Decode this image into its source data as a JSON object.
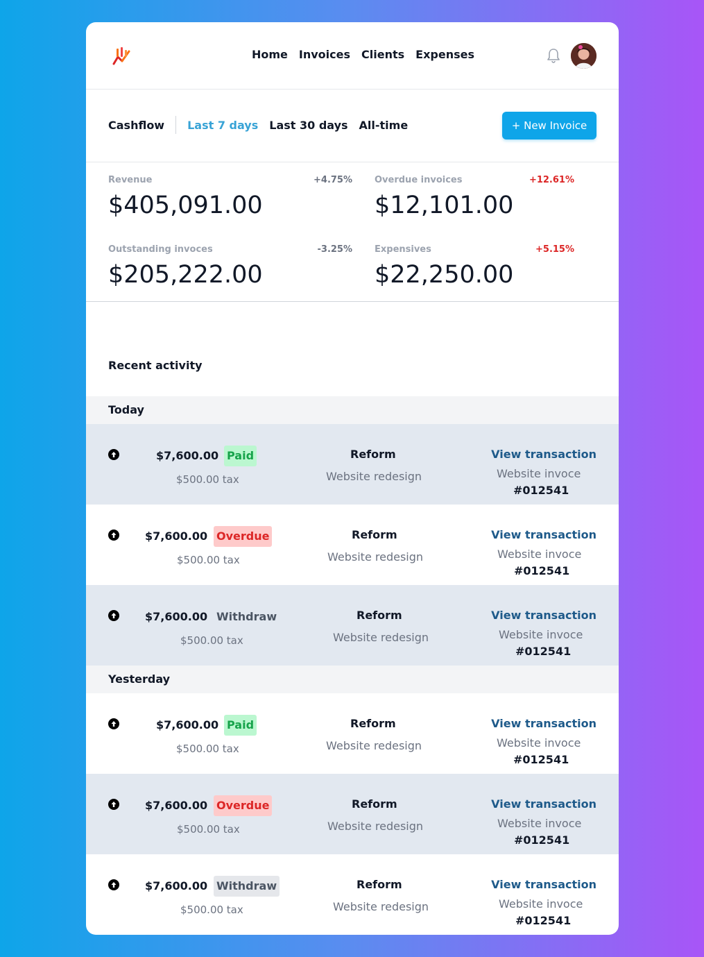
{
  "nav": {
    "items": [
      "Home",
      "Invoices",
      "Clients",
      "Expenses"
    ]
  },
  "filters": {
    "cashflow": "Cashflow",
    "options": [
      "Last 7 days",
      "Last 30 days",
      "All-time"
    ],
    "active": "Last 7 days"
  },
  "new_invoice_label": "+ New Invoice",
  "stats": [
    {
      "label": "Revenue",
      "delta": "+4.75%",
      "value": "$405,091.00"
    },
    {
      "label": "Overdue invoices",
      "delta": "+12.61%",
      "value": "$12,101.00"
    },
    {
      "label": "Outstanding invoces",
      "delta": "-3.25%",
      "value": "$205,222.00"
    },
    {
      "label": "Expensives",
      "delta": "+5.15%",
      "value": "$22,250.00"
    }
  ],
  "activity": {
    "title": "Recent activity",
    "groups": [
      {
        "label": "Today",
        "rows": [
          {
            "amount": "$7,600.00",
            "status": "Paid",
            "tax": "$500.00 tax",
            "client": "Reform",
            "project": "Website redesign",
            "link": "View transaction",
            "invoice": "Website invoce",
            "invoice_no": "#012541"
          },
          {
            "amount": "$7,600.00",
            "status": "Overdue",
            "tax": "$500.00 tax",
            "client": "Reform",
            "project": "Website redesign",
            "link": "View transaction",
            "invoice": "Website invoce",
            "invoice_no": "#012541"
          },
          {
            "amount": "$7,600.00",
            "status": "Withdraw",
            "tax": "$500.00 tax",
            "client": "Reform",
            "project": "Website redesign",
            "link": "View transaction",
            "invoice": "Website invoce",
            "invoice_no": "#012541"
          }
        ]
      },
      {
        "label": "Yesterday",
        "rows": [
          {
            "amount": "$7,600.00",
            "status": "Paid",
            "tax": "$500.00 tax",
            "client": "Reform",
            "project": "Website redesign",
            "link": "View transaction",
            "invoice": "Website invoce",
            "invoice_no": "#012541"
          },
          {
            "amount": "$7,600.00",
            "status": "Overdue",
            "tax": "$500.00 tax",
            "client": "Reform",
            "project": "Website redesign",
            "link": "View transaction",
            "invoice": "Website invoce",
            "invoice_no": "#012541"
          },
          {
            "amount": "$7,600.00",
            "status": "Withdraw",
            "tax": "$500.00 tax",
            "client": "Reform",
            "project": "Website redesign",
            "link": "View transaction",
            "invoice": "Website invoce",
            "invoice_no": "#012541"
          }
        ]
      }
    ]
  },
  "colors": {
    "accent": "#0ea5e9",
    "active_filter": "#38a3d6",
    "link": "#1e5a8a",
    "negative": "#dc2626"
  },
  "icons": {
    "logo": "bar-chart-logo",
    "bell": "bell-icon",
    "avatar": "user-avatar",
    "row": "arrow-up-circle-icon"
  }
}
